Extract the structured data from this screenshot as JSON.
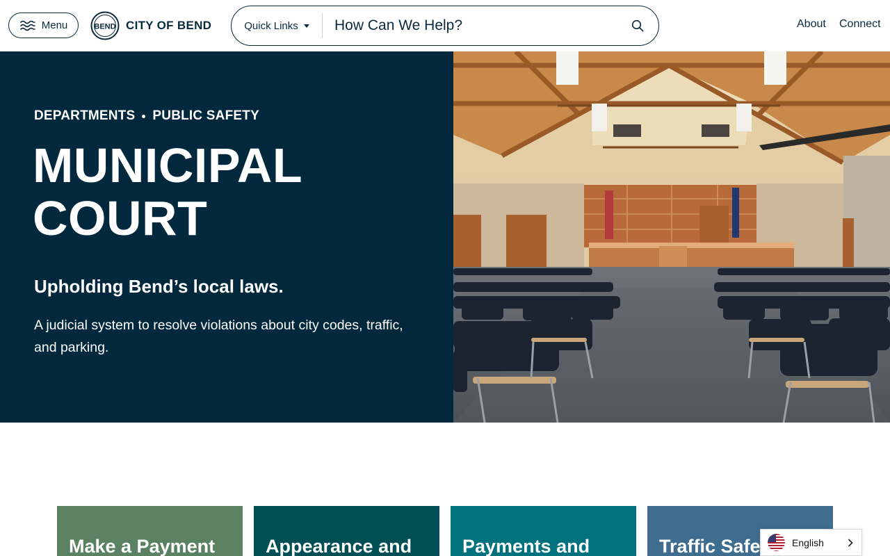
{
  "header": {
    "menu_label": "Menu",
    "logo_text": "CITY OF BEND",
    "logo_seal_text": "BEND",
    "quick_links_label": "Quick Links",
    "search_placeholder": "How Can We Help?",
    "links": [
      {
        "label": "About"
      },
      {
        "label": "Connect"
      }
    ]
  },
  "hero": {
    "breadcrumbs": [
      "DEPARTMENTS",
      "PUBLIC SAFETY"
    ],
    "title_line1": "MUNICIPAL",
    "title_line2": "COURT",
    "subtitle": "Upholding Bend’s local laws.",
    "description": "A judicial system to resolve violations about city codes, traffic, and parking."
  },
  "cards": [
    {
      "label": "Make a Payment",
      "color": "#5a8262"
    },
    {
      "label": "Appearance and",
      "color": "#004f55"
    },
    {
      "label": "Payments and",
      "color": "#00727d"
    },
    {
      "label": "Traffic Safety",
      "color": "#3f6d8f"
    }
  ],
  "language_widget": {
    "label": "English",
    "flag_icon": "us-flag-icon"
  },
  "colors": {
    "navy": "#02283d",
    "text_dark": "#0a2a3c"
  }
}
